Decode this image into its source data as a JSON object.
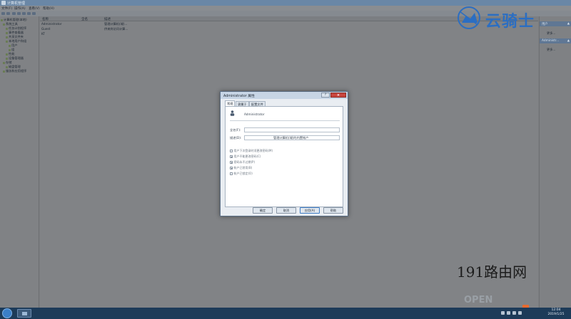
{
  "window": {
    "title": "计算机管理",
    "menu": [
      "文件(F)",
      "操作(A)",
      "查看(V)",
      "帮助(H)"
    ]
  },
  "tree": {
    "items": [
      "计算机管理(本地)",
      "系统工具",
      "任务计划程序",
      "事件查看器",
      "共享文件夹",
      "本地用户和组",
      "用户",
      "组",
      "性能",
      "设备管理器",
      "存储",
      "磁盘管理",
      "服务和应用程序"
    ]
  },
  "list": {
    "columns": [
      "名称",
      "全名",
      "描述"
    ],
    "rows": [
      {
        "name": "Administrator",
        "full": "",
        "desc": "管理计算机(域)..."
      },
      {
        "name": "Guest",
        "full": "",
        "desc": "供来宾访问计算..."
      },
      {
        "name": "KT",
        "full": "",
        "desc": ""
      }
    ]
  },
  "actions": {
    "header1": "用户",
    "more1": "更多...",
    "header2": "Administr...",
    "more2": "更多..."
  },
  "dialog": {
    "title": "Administrator 属性",
    "help": "?",
    "close": "×",
    "tabs": [
      "常规",
      "隶属于",
      "配置文件"
    ],
    "username": "Administrator",
    "fullname_label": "全名(F):",
    "fullname_value": "",
    "desc_label": "描述(D):",
    "desc_value": "管理计算机(域)的内置帐户",
    "checks": [
      {
        "label": "用户下次登录时须更改密码(M)",
        "checked": false
      },
      {
        "label": "用户不能更改密码(C)",
        "checked": true
      },
      {
        "label": "密码永不过期(P)",
        "checked": true
      },
      {
        "label": "帐户已禁用(B)",
        "checked": true
      },
      {
        "label": "帐户已锁定(O)",
        "checked": false
      }
    ],
    "buttons": [
      "确定",
      "取消",
      "应用(A)",
      "帮助"
    ]
  },
  "watermarks": {
    "yunqishi": "云骑士",
    "site191": "191路由网",
    "open": "OPEN"
  },
  "taskbar": {
    "time": "12:04",
    "date": "2019/1/25"
  }
}
